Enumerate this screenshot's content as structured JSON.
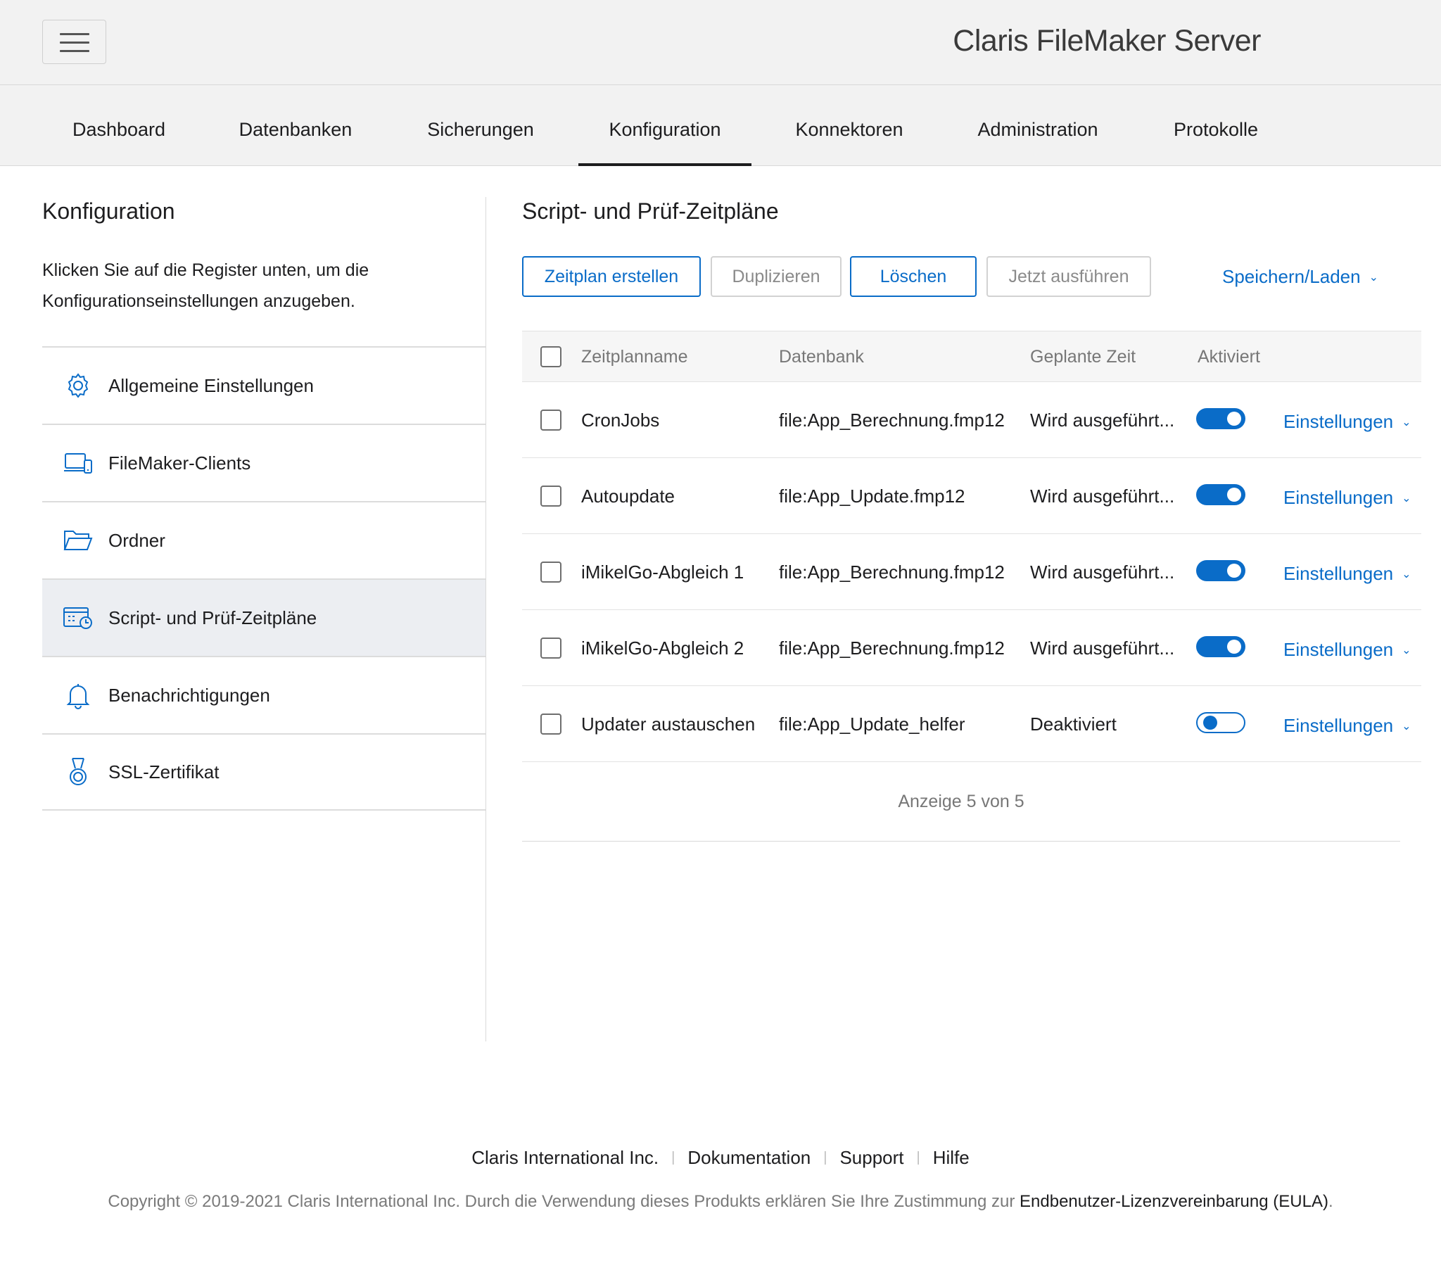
{
  "header": {
    "brand": "Claris FileMaker Server"
  },
  "nav": {
    "tabs": [
      {
        "label": "Dashboard"
      },
      {
        "label": "Datenbanken"
      },
      {
        "label": "Sicherungen"
      },
      {
        "label": "Konfiguration",
        "active": true
      },
      {
        "label": "Konnektoren"
      },
      {
        "label": "Administration"
      },
      {
        "label": "Protokolle"
      }
    ]
  },
  "sidebar": {
    "title": "Konfiguration",
    "description": "Klicken Sie auf die Register unten, um die Konfigurationseinstellungen anzugeben.",
    "items": [
      {
        "label": "Allgemeine Einstellungen",
        "icon": "gear-icon"
      },
      {
        "label": "FileMaker-Clients",
        "icon": "devices-icon"
      },
      {
        "label": "Ordner",
        "icon": "folder-icon"
      },
      {
        "label": "Script- und Prüf-Zeitpläne",
        "icon": "calendar-clock-icon",
        "active": true
      },
      {
        "label": "Benachrichtigungen",
        "icon": "bell-icon"
      },
      {
        "label": "SSL-Zertifikat",
        "icon": "medal-icon"
      }
    ]
  },
  "main": {
    "title": "Script- und Prüf-Zeitpläne",
    "toolbar": {
      "create_label": "Zeitplan erstellen",
      "duplicate_label": "Duplizieren",
      "delete_label": "Löschen",
      "run_now_label": "Jetzt ausführen",
      "save_load_label": "Speichern/Laden"
    },
    "table": {
      "columns": {
        "name": "Zeitplanname",
        "database": "Datenbank",
        "scheduled_time": "Geplante Zeit",
        "enabled": "Aktiviert"
      },
      "settings_label": "Einstellungen",
      "rows": [
        {
          "name": "CronJobs",
          "database": "file:App_Berechnung.fmp12",
          "scheduled_time": "Wird ausgeführt...",
          "enabled": true
        },
        {
          "name": "Autoupdate",
          "database": "file:App_Update.fmp12",
          "scheduled_time": "Wird ausgeführt...",
          "enabled": true
        },
        {
          "name": "iMikelGo-Abgleich 1",
          "database": "file:App_Berechnung.fmp12",
          "scheduled_time": "Wird ausgeführt...",
          "enabled": true
        },
        {
          "name": "iMikelGo-Abgleich 2",
          "database": "file:App_Berechnung.fmp12",
          "scheduled_time": "Wird ausgeführt...",
          "enabled": true
        },
        {
          "name": "Updater austauschen",
          "database": "file:App_Update_helfer",
          "scheduled_time": "Deaktiviert",
          "enabled": false
        }
      ],
      "count_text": "Anzeige 5 von 5"
    }
  },
  "footer": {
    "links": [
      "Claris International Inc.",
      "Dokumentation",
      "Support",
      "Hilfe"
    ],
    "copyright_prefix": "Copyright © 2019-2021 Claris International Inc. Durch die Verwendung dieses Produkts erklären Sie Ihre Zustimmung zur ",
    "eula_link": "Endbenutzer-Lizenzvereinbarung (EULA)",
    "copyright_suffix": "."
  },
  "colors": {
    "accent": "#0a6cc8",
    "header_bg": "#f2f2f2",
    "active_item_bg": "#eceef2"
  }
}
